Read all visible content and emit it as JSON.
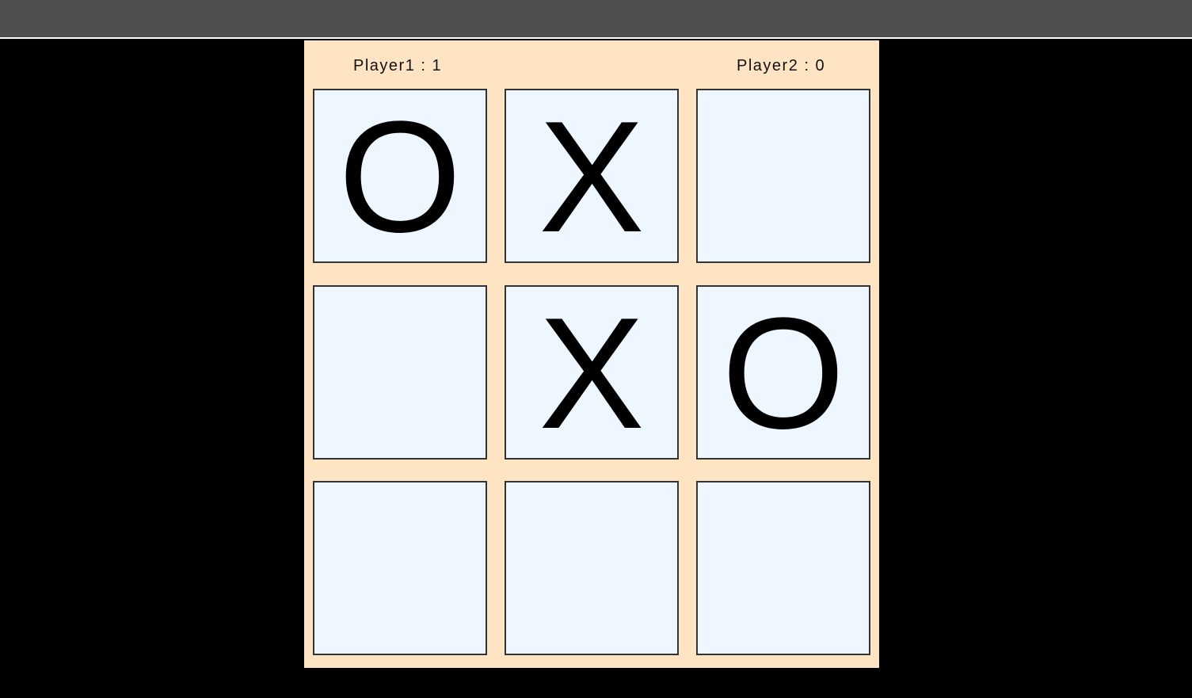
{
  "scores": {
    "player1": "Player1 : 1",
    "player2": "Player2 : 0"
  },
  "board": [
    [
      "O",
      "X",
      ""
    ],
    [
      "",
      "X",
      "O"
    ],
    [
      "",
      "",
      ""
    ]
  ],
  "colors": {
    "page_background": "#000000",
    "top_bar": "#4f4f4f",
    "panel_background": "#ffe4c4",
    "cell_background": "#eef7ff",
    "cell_border": "#333333",
    "mark": "#000000"
  }
}
